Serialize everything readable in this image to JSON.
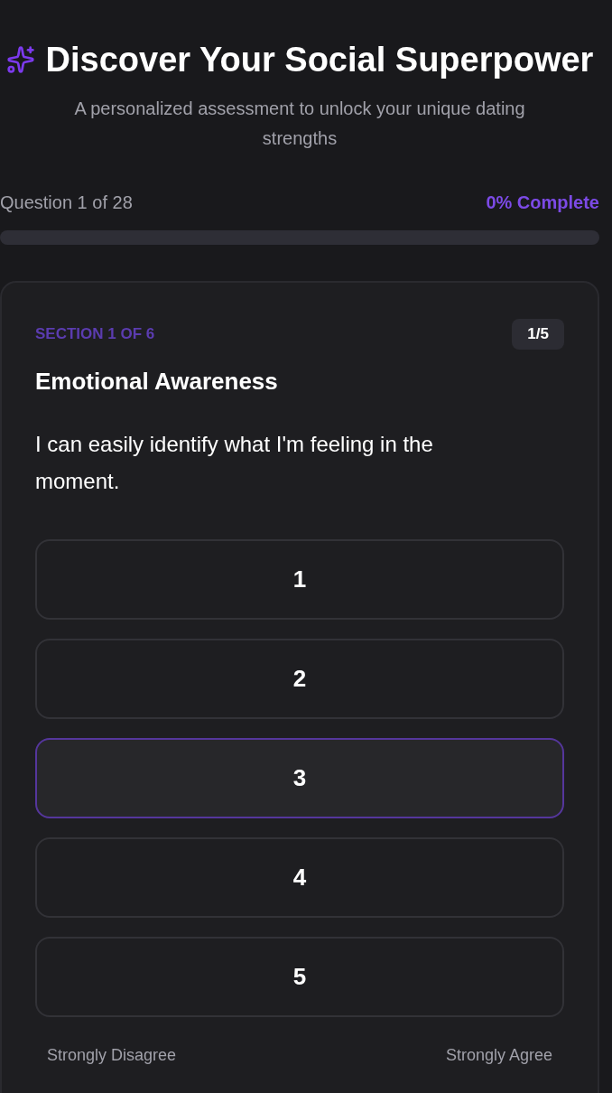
{
  "header": {
    "title": "Discover Your Social Superpower",
    "subtitle": "A personalized assessment to unlock your unique dating strengths"
  },
  "progress": {
    "question_label": "Question 1 of 28",
    "complete_label": "0% Complete"
  },
  "card": {
    "section_label": "SECTION 1 OF 6",
    "counter": "1/5",
    "category": "Emotional Awareness",
    "question": "I can easily identify what I'm feeling in the moment.",
    "options": [
      {
        "label": "1",
        "selected": false
      },
      {
        "label": "2",
        "selected": false
      },
      {
        "label": "3",
        "selected": true
      },
      {
        "label": "4",
        "selected": false
      },
      {
        "label": "5",
        "selected": false
      }
    ],
    "scale": {
      "low": "Strongly Disagree",
      "high": "Strongly Agree"
    }
  }
}
